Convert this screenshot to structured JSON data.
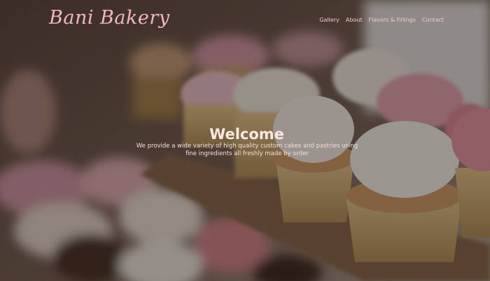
{
  "brand": {
    "name": "Bani Bakery"
  },
  "nav": {
    "items": [
      {
        "label": "Gallery"
      },
      {
        "label": "About"
      },
      {
        "label": "Flavors & Fillings"
      },
      {
        "label": "Contact"
      }
    ]
  },
  "hero": {
    "title": "Welcome",
    "subtitle": "We provide a wide variety of high quality custom cakes and pastries using fine ingredients all freshly made by order"
  },
  "colors": {
    "logo": "#f2b7c0",
    "nav_link": "#f6c6cf",
    "title": "#fbe8e2",
    "overlay": "rgba(20,12,10,0.42)"
  }
}
